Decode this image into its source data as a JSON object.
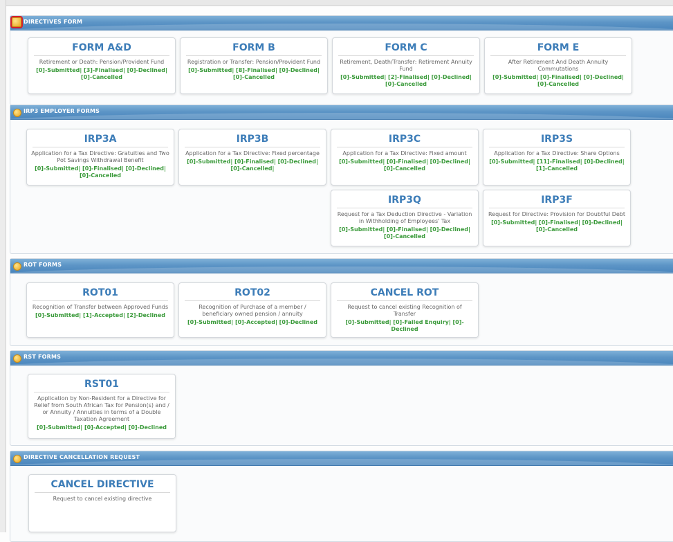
{
  "sections": {
    "directives": {
      "title": "DIRECTIVES FORM",
      "cards": [
        {
          "title": "FORM A&D",
          "desc": "Retirement or Death: Pension/Provident Fund",
          "status": "[0]-Submitted| [3]-Finalised| [0]-Declined| [0]-Cancelled"
        },
        {
          "title": "FORM B",
          "desc": "Registration or Transfer: Pension/Provident Fund",
          "status": "[0]-Submitted| [8]-Finalised| [0]-Declined| [0]-Cancelled"
        },
        {
          "title": "FORM C",
          "desc": "Retirement, Death/Transfer: Retirement Annuity Fund",
          "status": "[0]-Submitted| [2]-Finalised| [0]-Declined| [0]-Cancelled"
        },
        {
          "title": "FORM E",
          "desc": "After Retirement And Death Annuity Commutations",
          "status": "[0]-Submitted| [0]-Finalised| [0]-Declined| [0]-Cancelled"
        }
      ]
    },
    "irp3": {
      "title": "IRP3 EMPLOYER FORMS",
      "cards": [
        {
          "title": "IRP3A",
          "desc": "Application for a Tax Directive: Gratuities and Two Pot Savings Withdrawal Benefit",
          "status": "[0]-Submitted| [0]-Finalised| [0]-Declined| [0]-Cancelled"
        },
        {
          "title": "IRP3B",
          "desc": "Application for a Tax Directive: Fixed percentage",
          "status": "[0]-Submitted| [0]-Finalised| [0]-Declined| [0]-Cancelled|"
        },
        {
          "title": "IRP3C",
          "desc": "Application for a Tax Directive: Fixed amount",
          "status": "[0]-Submitted| [0]-Finalised| [0]-Declined| [0]-Cancelled"
        },
        {
          "title": "IRP3S",
          "desc": "Application for a Tax Directive: Share Options",
          "status": "[0]-Submitted| [11]-Finalised| [0]-Declined| [1]-Cancelled"
        },
        {
          "title": "IRP3Q",
          "desc": "Request for a Tax Deduction Directive - Variation in Withholding of Employees' Tax",
          "status": "[0]-Submitted| [0]-Finalised| [0]-Declined| [0]-Cancelled"
        },
        {
          "title": "IRP3F",
          "desc": "Request for Directive: Provision for Doubtful Debt",
          "status": "[0]-Submitted| [0]-Finalised| [0]-Declined| [0]-Cancelled"
        }
      ]
    },
    "rot": {
      "title": "ROT FORMS",
      "cards": [
        {
          "title": "ROT01",
          "desc": "Recognition of Transfer between Approved Funds",
          "status": "[0]-Submitted| [1]-Accepted| [2]-Declined"
        },
        {
          "title": "ROT02",
          "desc": "Recognition of Purchase of a member / beneficiary owned pension / annuity",
          "status": "[0]-Submitted| [0]-Accepted| [0]-Declined"
        },
        {
          "title": "CANCEL ROT",
          "desc": "Request to cancel existing Recognition of Transfer",
          "status": "[0]-Submitted| [0]-Failed Enquiry| [0]-Declined"
        }
      ]
    },
    "rst": {
      "title": "RST FORMS",
      "cards": [
        {
          "title": "RST01",
          "desc": "Application by Non-Resident for a Directive for Relief from South African Tax for Pension(s) and / or Annuity / Annuities in terms of a Double Taxation Agreement",
          "status": "[0]-Submitted| [0]-Accepted| [0]-Declined"
        }
      ]
    },
    "cancellation": {
      "title": "DIRECTIVE CANCELLATION REQUEST",
      "cards": [
        {
          "title": "CANCEL DIRECTIVE",
          "desc": "Request to cancel existing directive"
        }
      ]
    }
  },
  "colors": {
    "header_blue": "#4a86bd",
    "title_blue": "#3d7db8",
    "status_green": "#3a9a3a",
    "highlight_red": "#d4202b"
  },
  "icons": {
    "section_header": "gold-circle-icon"
  }
}
